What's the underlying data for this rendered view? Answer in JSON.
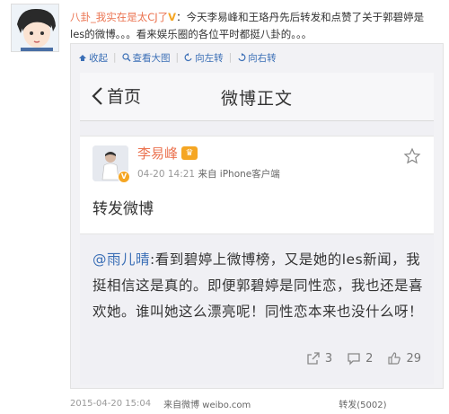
{
  "post": {
    "author": "八卦_我实在是太CJ了",
    "text": "：今天李易峰和王珞丹先后转发和点赞了关于郭碧婷是les的微博。。。看来娱乐圈的各位平时都挺八卦的。。。"
  },
  "toolbar": {
    "collapse": "收起",
    "view_large": "查看大图",
    "rotate_left": "向左转",
    "rotate_right": "向右转"
  },
  "screenshot": {
    "nav": {
      "back_label": "首页",
      "title": "微博正文"
    },
    "card": {
      "user_name": "李易峰",
      "time": "04-20 14:21",
      "source": "来自 iPhone客户端",
      "repost_text": "转发微博"
    },
    "original": {
      "mention": "@雨儿晴",
      "text": ":看到碧婷上微博榜，又是她的les新闻，我挺相信这是真的。即便郭碧婷是同性恋，我也还是喜欢她。谁叫她这么漂亮呢！同性恋本来也没什么呀！"
    },
    "stats": {
      "reposts": "3",
      "comments": "2",
      "likes": "29"
    }
  },
  "footer": {
    "timestamp": "2015-04-20 15:04",
    "via": "来自微博 weibo.com",
    "forward": "转发(5002)"
  },
  "colors": {
    "accent_orange": "#eb7350",
    "link_blue": "#3b6fb6",
    "verified_gold": "#f5a623"
  }
}
